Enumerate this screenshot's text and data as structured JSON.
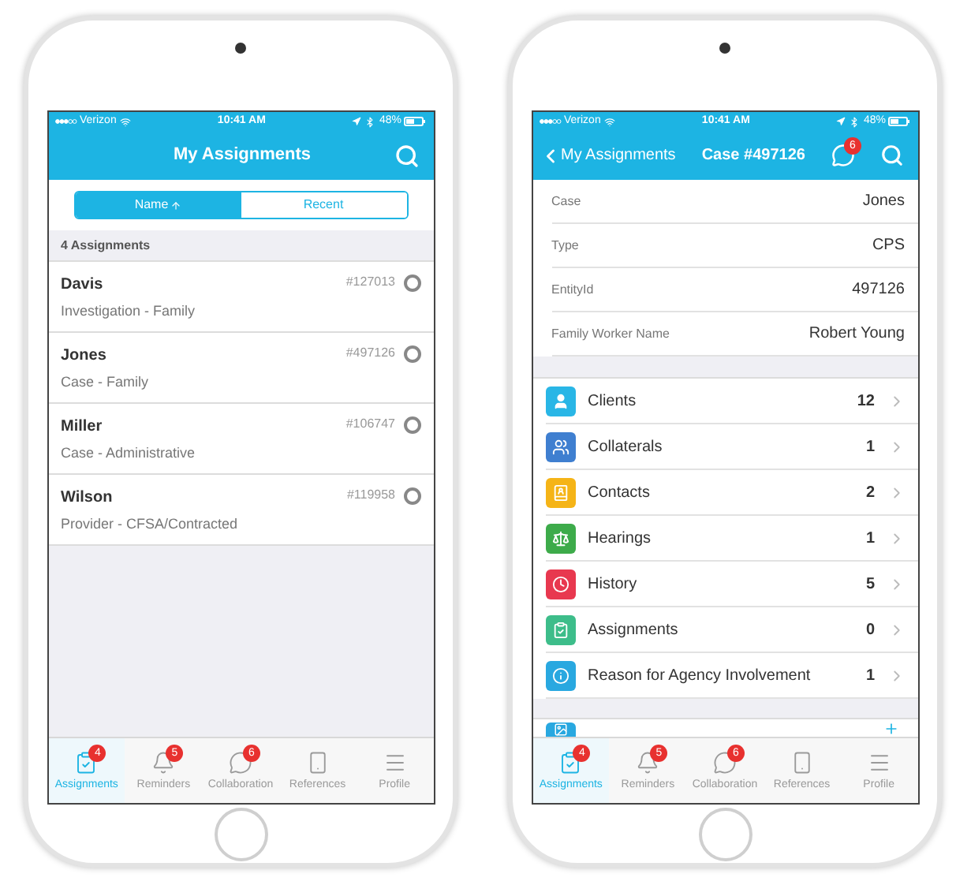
{
  "assignments_screen": {
    "status_bar": {
      "carrier": "Verizon",
      "time": "10:41 AM",
      "battery": "48%"
    },
    "nav": {
      "title": "My Assignments"
    },
    "segments": [
      {
        "label": "Name",
        "sort": true,
        "selected": true
      },
      {
        "label": "Recent",
        "sort": false,
        "selected": false
      }
    ],
    "list_header": "4 Assignments",
    "rows": [
      {
        "name": "Davis",
        "subtitle": "Investigation - Family",
        "number": "#127013",
        "selected": false
      },
      {
        "name": "Jones",
        "subtitle": "Case - Family",
        "number": "#497126",
        "selected": false
      },
      {
        "name": "Miller",
        "subtitle": "Case - Administrative",
        "number": "#106747",
        "selected": false
      },
      {
        "name": "Wilson",
        "subtitle": "Provider - CFSA/Contracted",
        "number": "#119958",
        "selected": false
      }
    ],
    "tab_bar": [
      {
        "kind": "clipboard",
        "label": "Assignments",
        "badge": "4",
        "selected": true
      },
      {
        "kind": "bell",
        "label": "Reminders",
        "badge": "5",
        "selected": false
      },
      {
        "kind": "chat",
        "label": "Collaboration",
        "badge": "6",
        "selected": false
      },
      {
        "kind": "phone",
        "label": "References",
        "selected": false
      },
      {
        "kind": "menu",
        "label": "Profile",
        "selected": false
      }
    ]
  },
  "case_screen": {
    "status_bar": {
      "carrier": "Verizon",
      "time": "10:41 AM",
      "battery": "48%"
    },
    "nav": {
      "back": "My Assignments",
      "title": "Case #497126",
      "chat_badge": "6"
    },
    "details": [
      {
        "label": "Case",
        "value": "Jones"
      },
      {
        "label": "Type",
        "value": "CPS"
      },
      {
        "label": "EntityId",
        "value": "497126"
      },
      {
        "label": "Family Worker Name",
        "value": "Robert Young"
      }
    ],
    "sections": [
      {
        "kind": "person",
        "color": "#29b6e6",
        "label": "Clients",
        "count": "12"
      },
      {
        "kind": "group",
        "color": "#3f7fd0",
        "label": "Collaterals",
        "count": "1"
      },
      {
        "kind": "contacts",
        "color": "#f5b417",
        "label": "Contacts",
        "count": "2"
      },
      {
        "kind": "scales",
        "color": "#3dab4a",
        "label": "Hearings",
        "count": "1"
      },
      {
        "kind": "clock",
        "color": "#e8384f",
        "label": "History",
        "count": "5"
      },
      {
        "kind": "clipboard",
        "color": "#3dbd8a",
        "label": "Assignments",
        "count": "0"
      },
      {
        "kind": "info",
        "color": "#29a8e0",
        "label": "Reason for Agency Involvement",
        "count": "1"
      }
    ],
    "tab_bar": [
      {
        "kind": "clipboard",
        "label": "Assignments",
        "badge": "4",
        "selected": true
      },
      {
        "kind": "bell",
        "label": "Reminders",
        "badge": "5",
        "selected": false
      },
      {
        "kind": "chat",
        "label": "Collaboration",
        "badge": "6",
        "selected": false
      },
      {
        "kind": "phone",
        "label": "References",
        "selected": false
      },
      {
        "kind": "menu",
        "label": "Profile",
        "selected": false
      }
    ]
  }
}
